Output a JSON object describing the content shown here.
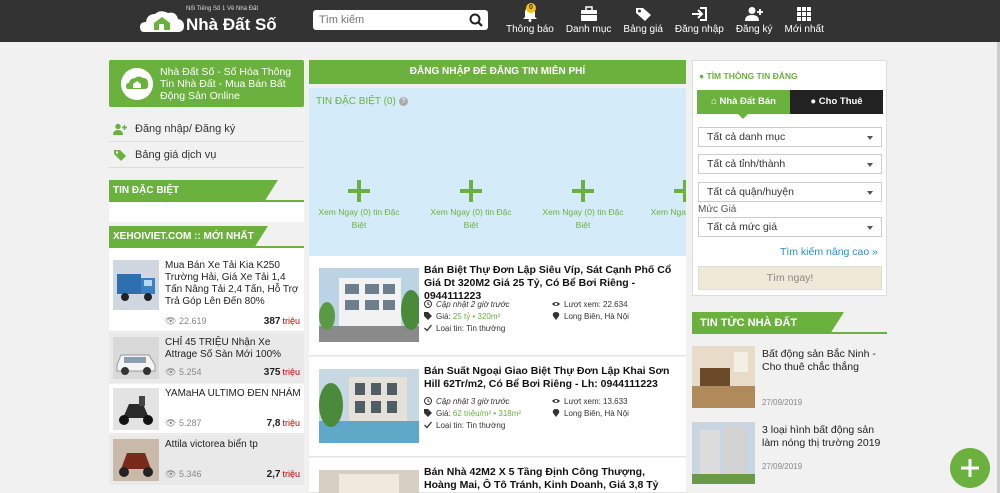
{
  "header": {
    "logo_tagline": "Nổi Tiếng Số 1 Về Nhà Đất",
    "logo_brand": "Nhà Đất Số",
    "search_placeholder": "Tìm kiếm",
    "nav": [
      {
        "label": "Thông báo",
        "icon": "bell-icon",
        "badge": "0"
      },
      {
        "label": "Danh mục",
        "icon": "briefcase-icon"
      },
      {
        "label": "Bảng giá",
        "icon": "tag-icon"
      },
      {
        "label": "Đăng nhập",
        "icon": "sign-in-icon"
      },
      {
        "label": "Đăng ký",
        "icon": "user-plus-icon"
      },
      {
        "label": "Mới nhất",
        "icon": "grid-icon"
      }
    ]
  },
  "left": {
    "hero_text": "Nhà Đất Số - Số Hóa Thông Tin Nhà Đất - Mua Bán Bất Động Sản Online",
    "links": [
      {
        "label": "Đăng nhập/ Đăng ký",
        "icon": "user-plus-icon"
      },
      {
        "label": "Bảng giá dịch vụ",
        "icon": "tag-icon"
      }
    ],
    "special_title": "TIN ĐẶC BIỆT",
    "xehoi_title": "XEHOIVIET.COM :: MỚI NHẤT",
    "cars": [
      {
        "title": "Mua Bán Xe Tải Kia K250 Trường Hải, Giá Xe Tải 1,4 Tấn Nâng Tải 2,4 Tấn, Hỗ Trợ Trả Góp Lên Đến 80%",
        "views": "22.619",
        "price": "387",
        "unit": "triệu"
      },
      {
        "title": "CHỈ 45 TRIỆU Nhận Xe Attrage Số Sàn Mới 100%",
        "views": "5.254",
        "price": "375",
        "unit": "triệu"
      },
      {
        "title": "YAMaHA ULTIMO ĐEN NHÁM",
        "views": "5.287",
        "price": "7,8",
        "unit": "triệu"
      },
      {
        "title": "Attila victorea biển tp",
        "views": "5.346",
        "price": "2,7",
        "unit": "triệu"
      }
    ]
  },
  "middle": {
    "login_banner": "ĐĂNG NHẬP ĐỂ ĐĂNG TIN MIỄN PHÍ",
    "special_label": "TIN ĐẶC BIỆT (0)",
    "help_glyph": "?",
    "slots": [
      "Xem Ngay (0) tin Đặc Biệt",
      "Xem Ngay (0) tin Đặc Biệt",
      "Xem Ngay (0) tin Đặc Biệt",
      "Xem Nga"
    ],
    "listings": [
      {
        "title": "Bán Biệt Thự Đơn Lập Siêu Víp, Sát Cạnh Phố Cổ Giá Dt 320M2 Giá 25 Tỷ, Có Bể Bơi Riêng - 0944111223",
        "posted": "Cập nhật 2 giờ trước",
        "price_label": "Giá:",
        "price": "25 tỷ",
        "area": "320m²",
        "type": "Loại tin: Tin thường",
        "views": "Lượt xem: 22.634",
        "location": "Long Biên, Hà Nội"
      },
      {
        "title": "Bán Suất Ngoại Giao Biệt Thự Đơn Lập Khai Sơn Hill 62Tr/m2, Có Bể Bơi Riêng - Lh: 0944111223",
        "posted": "Cập nhật 3 giờ trước",
        "price_label": "Giá:",
        "price": "62 triệu/m²",
        "area": "318m²",
        "type": "Loại tin: Tin thường",
        "views": "Lượt xem: 13.633",
        "location": "Long Biên, Hà Nội"
      },
      {
        "title": "Bán Nhà 42M2 X 5 Tầng Định Công Thượng, Hoàng Mai, Ô Tô Tránh, Kinh Doanh, Giá 3,8 Tỷ"
      }
    ]
  },
  "right": {
    "search_title": "TÌM THÔNG TIN ĐĂNG",
    "tab_sell": "Nhà Đất Bán",
    "tab_rent": "Cho Thuê",
    "selects": [
      "Tất cả danh mục",
      "Tất cả tỉnh/thành",
      "Tất cả quận/huyện"
    ],
    "price_label": "Mức Giá",
    "price_select": "Tất cả mức giá",
    "advanced": "Tìm kiếm nâng cao",
    "find_button": "Tìm ngay!",
    "news_title": "TIN TỨC NHÀ ĐẤT",
    "news": [
      {
        "title": "Bất động sản Bắc Ninh - Cho thuê chắc thắng",
        "date": "27/09/2019"
      },
      {
        "title": "3 loại hình bất động sản làm nóng thị trường 2019",
        "date": "27/09/2019"
      }
    ]
  },
  "colors": {
    "brand_green": "#6bb13d",
    "topbar": "#333333",
    "special_bg": "#d4ecfa",
    "link_blue": "#2a8fd0"
  }
}
